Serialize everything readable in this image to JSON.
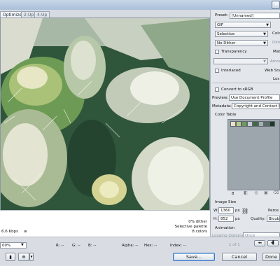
{
  "tabs": [
    {
      "label": "Optimized"
    },
    {
      "label": "2-Up"
    },
    {
      "label": "4-Up"
    }
  ],
  "status": {
    "left_text": "6.6 Kbps",
    "dither": "0% dither",
    "palette": "Selective palette",
    "colors": "8 colors"
  },
  "bottom": {
    "zoom_value": "00%",
    "readouts": {
      "r": "R: --",
      "g": "G: --",
      "b": "B: --",
      "alpha": "Alpha: --",
      "hex": "Hex: --",
      "index": "Index: --"
    },
    "save_label": "Save...",
    "cancel_label": "Cancel",
    "done_label": "Done"
  },
  "settings": {
    "preset_label": "Preset:",
    "preset_value": "[Unnamed]",
    "format_value": "GIF",
    "reduction_value": "Selective",
    "colors_label": "Colo",
    "dither_algo_value": "No Dither",
    "dither_label": "Dithe",
    "transparency_label": "Transparency",
    "matte_label": "Matt",
    "transparency_dither_value": "",
    "amount_label": "Amou",
    "interlaced_label": "Interlaced",
    "web_snap_label": "Web Sna",
    "lossy_label": "Los",
    "convert_srgb_label": "Convert to sRGB",
    "preview_label": "Preview:",
    "preview_value": "Use Document Profile",
    "metadata_label": "Metadata:",
    "metadata_value": "Copyright and Contact Info"
  },
  "color_table": {
    "title": "Color Table",
    "swatches": [
      "#e9e3c4",
      "#b8c98f",
      "#6e9a58",
      "#c6ccd2",
      "#3f6a43",
      "#9fb2ad",
      "#5c6c67",
      "#1d3a27"
    ],
    "count": "8"
  },
  "image_size": {
    "title": "Image Size",
    "w_label": "W:",
    "w_value": "1360",
    "h_label": "H:",
    "h_value": "852",
    "unit": "px",
    "percent_label": "Perce",
    "quality_label": "Quality:",
    "quality_value": "Bicubic"
  },
  "animation": {
    "title": "Animation",
    "looping_label": "Looping Options:",
    "looping_value": "Once",
    "frame_counter": "1 of 1"
  },
  "icons": [
    "close-icon",
    "minimize-icon",
    "maximize-icon",
    "chain-link-icon",
    "trash-icon",
    "lock-icon",
    "add-color-icon",
    "first-frame-icon",
    "previous-frame-icon",
    "eye-icon"
  ]
}
